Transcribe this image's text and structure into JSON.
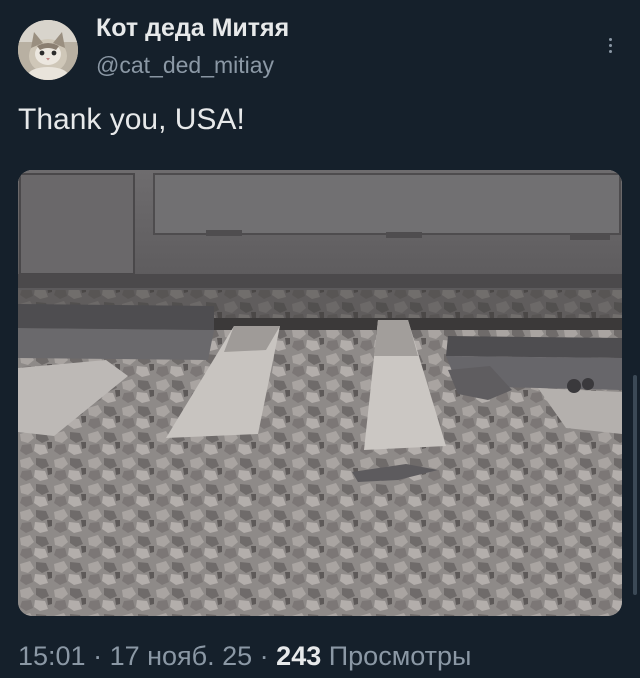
{
  "author": {
    "display_name": "Кот деда Митяя",
    "handle": "@cat_ded_mitiay",
    "avatar_icon": "cat-avatar"
  },
  "more_icon": "vertical-ellipsis-icon",
  "tweet": {
    "text": "Thank you, USA!",
    "media_icon": "train-wheels-on-rail-sleepers-photo"
  },
  "meta": {
    "time": "15:01",
    "separator": " · ",
    "date": "17 нояб. 25",
    "views_count": "243",
    "views_label": "Просмотры"
  },
  "colors": {
    "background": "#15202b",
    "primary_text": "#e7e9ea",
    "secondary_text": "#8b98a5"
  }
}
